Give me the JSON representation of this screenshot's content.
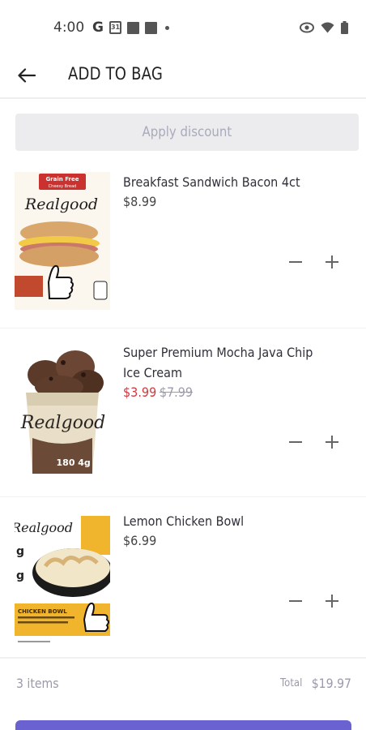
{
  "status_bar": {
    "time": "4:00",
    "left_icons": [
      "google-icon",
      "calendar-icon",
      "notification-icon",
      "notification-icon",
      "dot-icon"
    ],
    "calendar_day": "31",
    "google_letter": "G",
    "right_icons": [
      "eye-icon",
      "wifi-icon",
      "battery-icon"
    ]
  },
  "header": {
    "title": "ADD TO BAG",
    "back_icon": "back-arrow-icon"
  },
  "discount": {
    "label": "Apply discount"
  },
  "products": [
    {
      "name": "Breakfast Sandwich Bacon 4ct",
      "price": "$8.99",
      "image": {
        "brand": "Realgood",
        "badge": "Grain Free",
        "badge_sub": "Cheesy Bread"
      }
    },
    {
      "name": "Super Premium Mocha Java Chip Ice Cream",
      "price": "$3.99",
      "original_price": "$7.99",
      "image": {
        "brand": "Realgood",
        "cal": "180",
        "protein": "4g"
      }
    },
    {
      "name": "Lemon Chicken Bowl",
      "price": "$6.99",
      "image": {
        "brand": "Realgood",
        "badge": "CHICKEN BOWL",
        "side_a": "g",
        "side_b": "g"
      }
    }
  ],
  "summary": {
    "item_count": "3 items",
    "total_label": "Total",
    "total_value": "$19.97"
  },
  "colors": {
    "accent": "#6a62d0",
    "sale": "#d2383f",
    "muted": "#9a9aac",
    "discount_bg": "#ececee"
  }
}
